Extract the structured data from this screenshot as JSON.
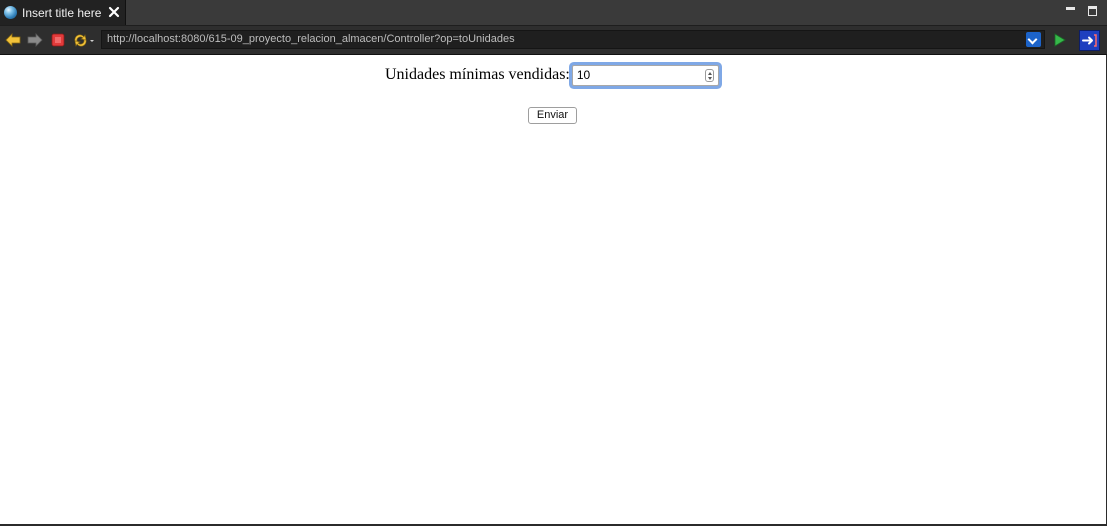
{
  "tab": {
    "title": "Insert title here",
    "icon": "globe-icon"
  },
  "toolbar": {
    "url": "http://localhost:8080/615-09_proyecto_relacion_almacen/Controller?op=toUnidades",
    "icons": [
      "back-arrow-icon",
      "forward-arrow-icon",
      "stop-icon",
      "refresh-icon",
      "url-dropdown-icon",
      "go-icon",
      "external-browser-icon"
    ]
  },
  "form": {
    "label": "Unidades mínimas vendidas:",
    "value": "10",
    "submit_label": "Enviar"
  },
  "colors": {
    "focus_ring": "#7fa8e6",
    "accent_blue": "#1c63c9",
    "go_green": "#36b84a",
    "stop_red": "#e23b3b"
  }
}
